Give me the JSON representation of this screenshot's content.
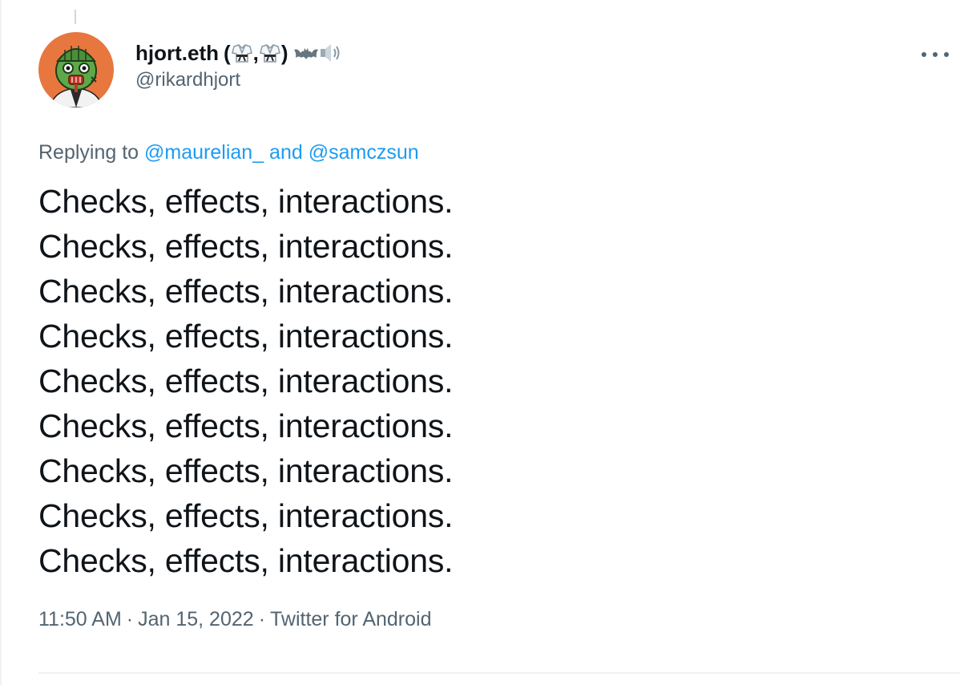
{
  "user": {
    "display_name": "hjort.eth",
    "handle": "@rikardhjort"
  },
  "reply": {
    "prefix": "Replying to",
    "mention1": "@maurelian_",
    "conjunction": "and",
    "mention2": "@samczsun"
  },
  "tweet": {
    "lines": [
      "Checks, effects, interactions.",
      "Checks, effects, interactions.",
      "Checks, effects, interactions.",
      "Checks, effects, interactions.",
      "Checks, effects, interactions.",
      "Checks, effects, interactions.",
      "Checks, effects, interactions.",
      "Checks, effects, interactions.",
      "Checks, effects, interactions."
    ]
  },
  "meta": {
    "time": "11:50 AM",
    "date": "Jan 15, 2022",
    "source": "Twitter for Android",
    "separator": "·"
  },
  "icons": {
    "more": "more-horizontal-icon",
    "name_emojis": [
      "martial-arts-uniform-emoji",
      "martial-arts-uniform-emoji",
      "bat-emoji",
      "speaker-emoji"
    ]
  },
  "colors": {
    "link": "#1d9bf0",
    "secondary_text": "#536471",
    "primary_text": "#0f1419",
    "avatar_background": "#e8773f"
  }
}
